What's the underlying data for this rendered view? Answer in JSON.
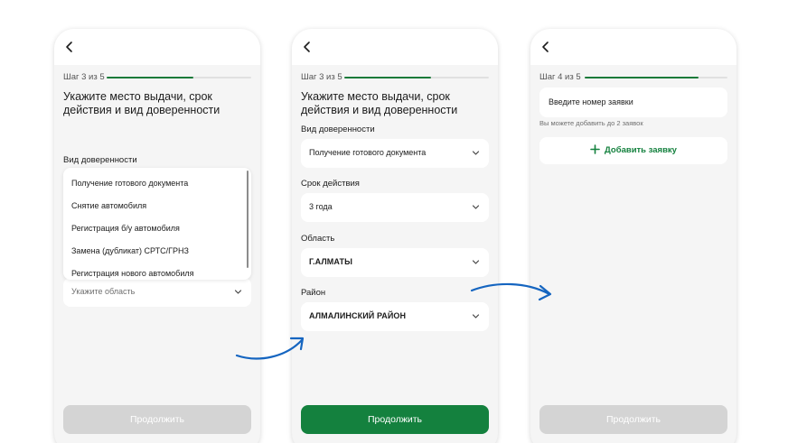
{
  "screen1": {
    "step_label": "Шаг 3 из 5",
    "progress": 0.6,
    "title": "Укажите место выдачи, срок действия и вид доверенности",
    "field_label": "Вид доверенности",
    "dropdown_items": [
      "Получение готового документа",
      "Снятие автомобиля",
      "Регистрация б/у автомобиля",
      "Замена (дубликат) СРТС/ГРНЗ",
      "Регистрация нового автомобиля"
    ],
    "region_placeholder": "Укажите область",
    "continue_label": "Продолжить"
  },
  "screen2": {
    "step_label": "Шаг 3 из 5",
    "progress": 0.6,
    "title": "Укажите место выдачи, срок действия и вид доверенности",
    "fields": [
      {
        "label": "Вид доверенности",
        "value": "Получение готового документа"
      },
      {
        "label": "Срок действия",
        "value": "3 года"
      },
      {
        "label": "Область",
        "value": "Г.АЛМАТЫ"
      },
      {
        "label": "Район",
        "value": "АЛМАЛИНСКИЙ РАЙОН"
      }
    ],
    "continue_label": "Продолжить"
  },
  "screen3": {
    "step_label": "Шаг 4 из 5",
    "progress": 0.8,
    "input_placeholder": "Введите номер заявки",
    "hint": "Вы можете добавить до 2 заявок",
    "add_label": "Добавить заявку",
    "continue_label": "Продолжить"
  },
  "colors": {
    "accent": "#14813e",
    "progress": "#1b7a3a",
    "disabled": "#d4d4d4",
    "arrow": "#1565c0",
    "background": "#f5f5f5"
  },
  "icons": [
    "back-arrow-icon",
    "chevron-down-icon",
    "plus-icon",
    "flow-arrow-icon"
  ]
}
